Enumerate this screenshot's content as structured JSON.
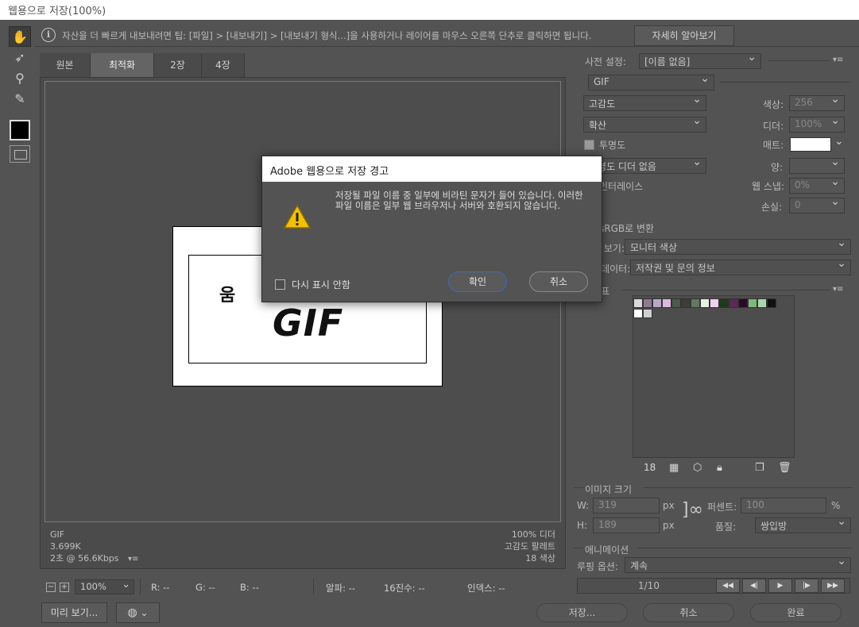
{
  "window": {
    "title": "웹용으로 저장(100%)"
  },
  "tip": {
    "text": "자산을 더 빠르게 내보내려면 팁: [파일] > [내보내기] > [내보내기 형식...]을 사용하거나 레이어를 마우스 오른쪽 단추로 클릭하면 됩니다.",
    "learn_more": "자세히 알아보기"
  },
  "tabs": [
    {
      "label": "원본"
    },
    {
      "label": "최적화"
    },
    {
      "label": "2장"
    },
    {
      "label": "4장"
    }
  ],
  "image": {
    "char": "움",
    "gif_text": "GIF"
  },
  "canvas_info": {
    "format": "GIF",
    "size": "3.699K",
    "speed": "2초 @ 56.6Kbps",
    "dither": "100% 디더",
    "palette": "고감도 팔레트",
    "colors": "18 색상"
  },
  "status": {
    "zoom": "100%",
    "r": "R: --",
    "g": "G: --",
    "b": "B: --",
    "alpha": "알파: --",
    "hex": "16진수: --",
    "index": "인덱스: --"
  },
  "bottom": {
    "preview": "미리 보기...",
    "save": "저장...",
    "cancel": "취소",
    "done": "완료"
  },
  "preset": {
    "label": "사전 설정:",
    "value": "[이름 없음]",
    "format": "GIF",
    "reduction": "고감도",
    "dither_algo": "확산",
    "colors_label": "색상:",
    "colors_value": "256",
    "dither_label": "디더:",
    "dither_value": "100%",
    "transparency": "투명도",
    "matte_label": "매트:",
    "trans_dither": "투명도 디더 없음",
    "amount_label": "양:",
    "interlace": "인터레이스",
    "web_snap_label": "웹 스냅:",
    "web_snap_value": "0%",
    "lossy_label": "손실:",
    "lossy_value": "0",
    "srgb": "sRGB로 변환",
    "preview_label": "미리 보기:",
    "preview_value": "모니터 색상",
    "metadata_label": "메타데이터:",
    "metadata_value": "저작권 및 문의 정보"
  },
  "color_table": {
    "label": "색상표",
    "count": "18",
    "colors": [
      "#d9d9d9",
      "#8c7b8e",
      "#b9a8c4",
      "#dcb9dc",
      "#4a5a4a",
      "#3d3d3d",
      "#5f7a5f",
      "#e8f0e0",
      "#f0d0f0",
      "#1e3a1e",
      "#5a2a5a",
      "#2a0a2a",
      "#7fb87f",
      "#a8d8a8",
      "#101010",
      "#ffffff",
      "#cfcfcf"
    ]
  },
  "image_size": {
    "label": "이미지 크기",
    "w_label": "W:",
    "w_value": "319",
    "h_label": "H:",
    "h_value": "189",
    "unit": "px",
    "percent_label": "퍼센트:",
    "percent_value": "100",
    "percent_unit": "%",
    "quality_label": "품질:",
    "quality_value": "쌍입방"
  },
  "animation": {
    "label": "애니메이션",
    "loop_label": "루핑 옵션:",
    "loop_value": "계속",
    "frame": "1/10"
  },
  "dialog": {
    "title": "Adobe 웹용으로 저장 경고",
    "message": "저장될 파일 이름 중 일부에 비라틴 문자가 들어 있습니다. 이러한 파일 이름은 일부 웹 브라우저나 서버와 호환되지 않습니다.",
    "dont_show": "다시 표시 안함",
    "ok": "확인",
    "cancel": "취소"
  },
  "colors": {
    "accent": "#3f6ab4",
    "bg": "#535353"
  }
}
